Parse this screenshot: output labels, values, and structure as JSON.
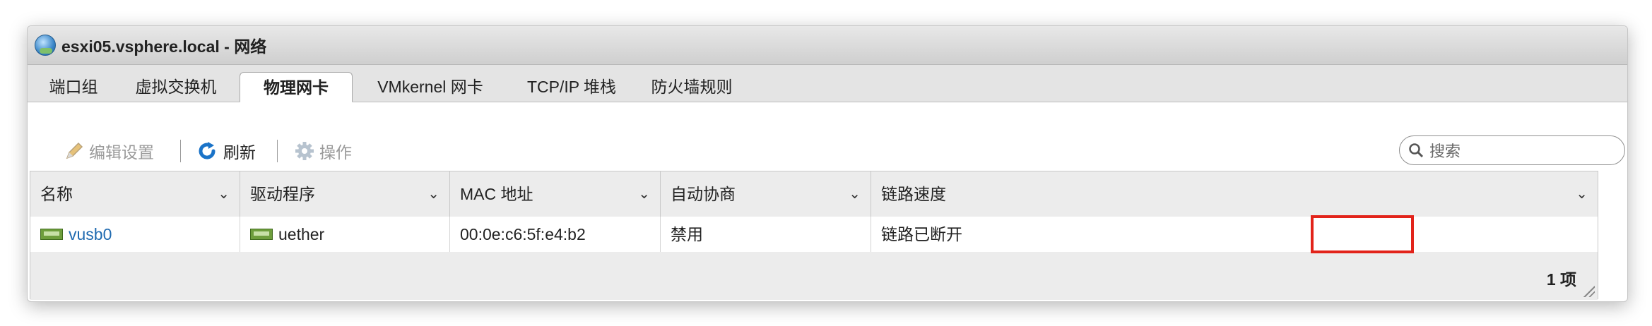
{
  "window": {
    "title": "esxi05.vsphere.local - 网络"
  },
  "tabs": [
    {
      "label": "端口组"
    },
    {
      "label": "虚拟交换机"
    },
    {
      "label": "物理网卡",
      "active": true
    },
    {
      "label": "VMkernel 网卡"
    },
    {
      "label": "TCP/IP 堆栈"
    },
    {
      "label": "防火墙规则"
    }
  ],
  "toolbar": {
    "edit_label": "编辑设置",
    "refresh_label": "刷新",
    "actions_label": "操作",
    "search_placeholder": "搜索"
  },
  "table": {
    "columns": [
      "名称",
      "驱动程序",
      "MAC 地址",
      "自动协商",
      "链路速度"
    ],
    "rows": [
      {
        "name": "vusb0",
        "driver": "uether",
        "mac": "00:0e:c6:5f:e4:b2",
        "autoneg": "禁用",
        "speed": "链路已断开"
      }
    ],
    "footer_count": "1 项"
  },
  "colors": {
    "highlight": "#e2231a",
    "link": "#1f6ab0",
    "refresh_icon": "#1a73c8"
  },
  "icons": [
    "globe-icon",
    "pencil-icon",
    "refresh-icon",
    "gear-icon",
    "search-icon",
    "nic-icon",
    "chevron-down-icon",
    "resize-grip-icon"
  ]
}
